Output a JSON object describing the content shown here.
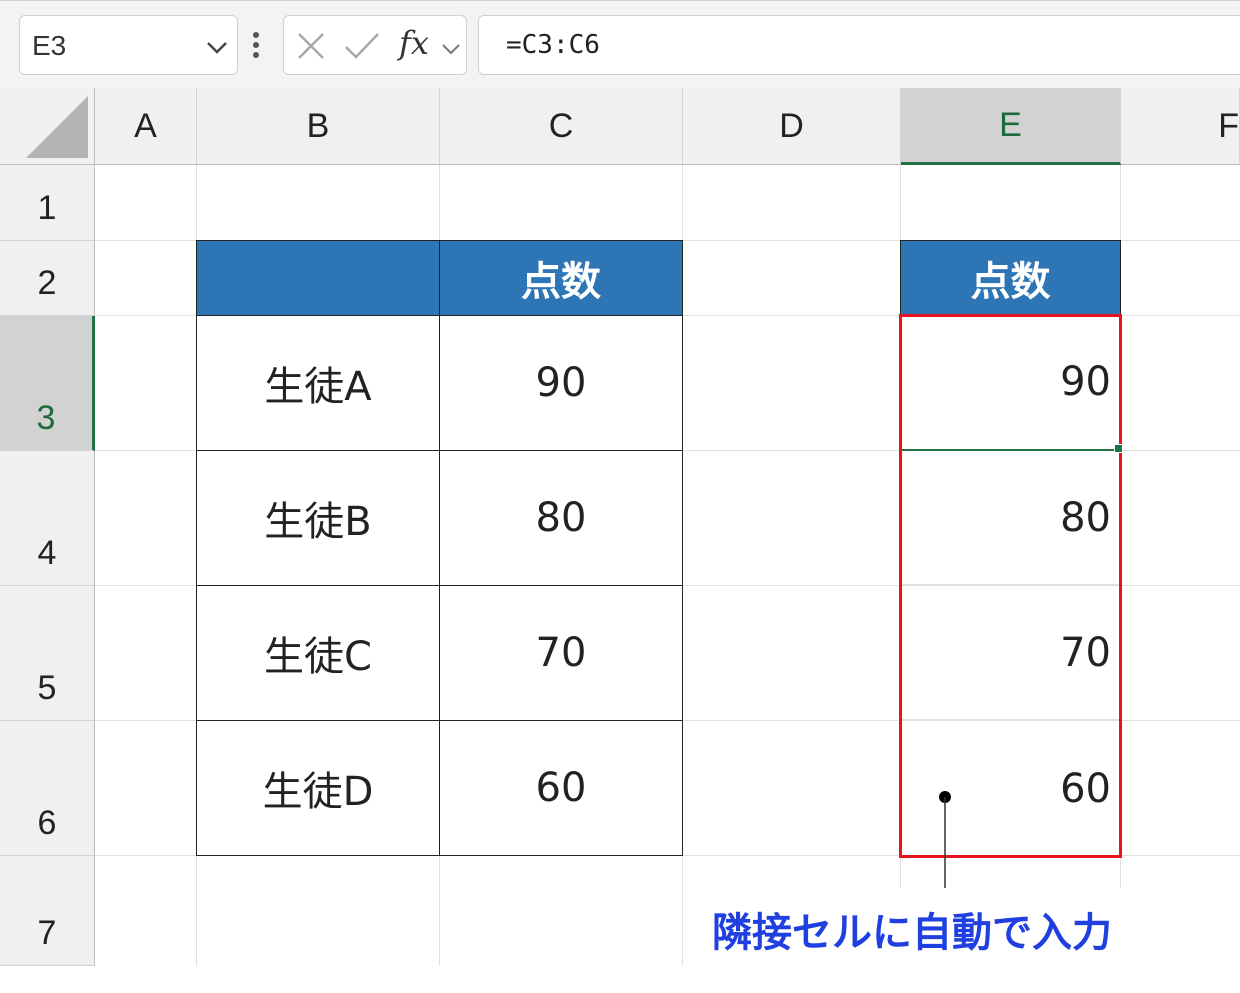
{
  "formula_bar": {
    "name_box": "E3",
    "formula": "=C3:C6",
    "fx_label": "fx"
  },
  "columns": [
    "A",
    "B",
    "C",
    "D",
    "E",
    "F"
  ],
  "rows": [
    "1",
    "2",
    "3",
    "4",
    "5",
    "6",
    "7"
  ],
  "table": {
    "header": "点数",
    "students": [
      "生徒A",
      "生徒B",
      "生徒C",
      "生徒D"
    ],
    "scores": [
      "90",
      "80",
      "70",
      "60"
    ]
  },
  "spill": {
    "header": "点数",
    "values": [
      "90",
      "80",
      "70",
      "60"
    ]
  },
  "annotation": "隣接セルに自動で入力",
  "colors": {
    "header_fill": "#2e75b6",
    "spill_border": "#e8141c",
    "selection": "#217346",
    "annotation": "#1f3fe0"
  }
}
